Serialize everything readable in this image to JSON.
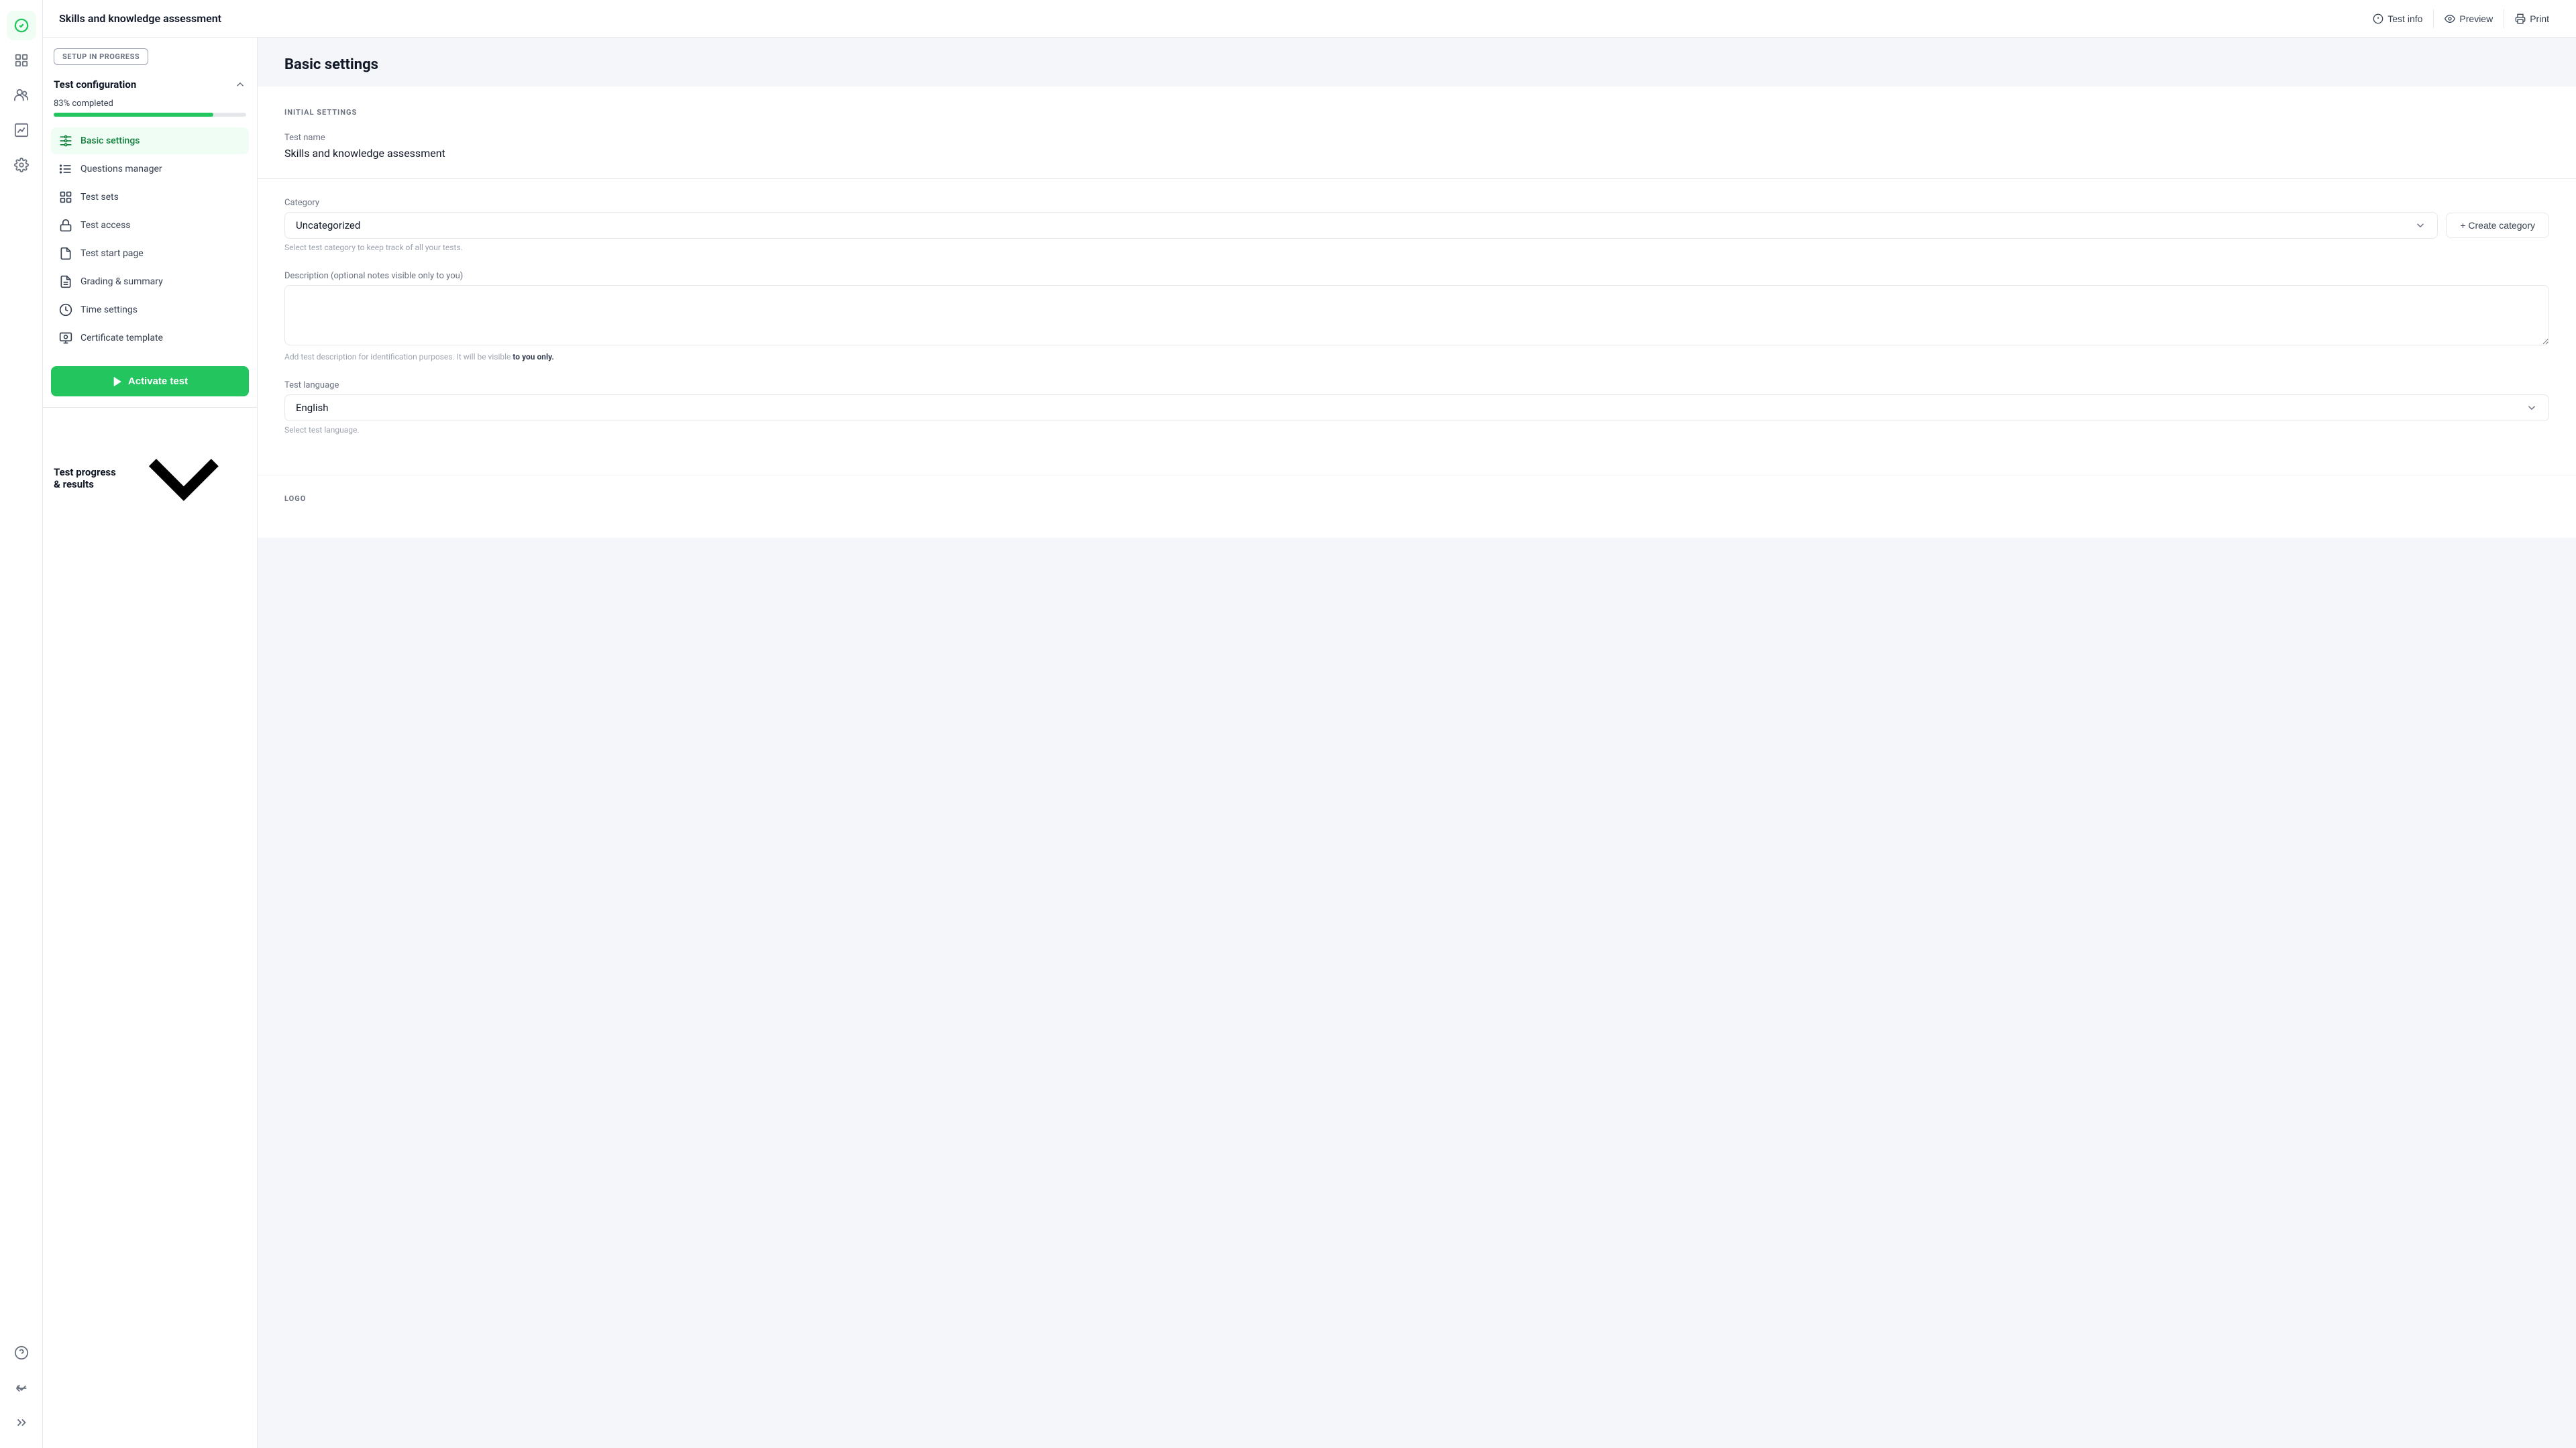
{
  "app": {
    "title": "Skills and knowledge assessment"
  },
  "header": {
    "title": "Skills and knowledge assessment",
    "actions": [
      {
        "id": "test-info",
        "label": "Test info",
        "icon": "info-circle"
      },
      {
        "id": "preview",
        "label": "Preview",
        "icon": "eye"
      },
      {
        "id": "print",
        "label": "Print",
        "icon": "printer"
      }
    ]
  },
  "sidebar": {
    "setup_badge": "SETUP IN PROGRESS",
    "section1": {
      "title": "Test configuration",
      "progress_label": "83% completed",
      "progress_value": 83
    },
    "nav_items": [
      {
        "id": "basic-settings",
        "label": "Basic settings",
        "active": true,
        "icon": "settings-sliders"
      },
      {
        "id": "questions-manager",
        "label": "Questions manager",
        "active": false,
        "icon": "list-adjust"
      },
      {
        "id": "test-sets",
        "label": "Test sets",
        "active": false,
        "icon": "grid"
      },
      {
        "id": "test-access",
        "label": "Test access",
        "active": false,
        "icon": "lock"
      },
      {
        "id": "test-start-page",
        "label": "Test start page",
        "active": false,
        "icon": "file-empty"
      },
      {
        "id": "grading-summary",
        "label": "Grading & summary",
        "active": false,
        "icon": "document-list"
      },
      {
        "id": "time-settings",
        "label": "Time settings",
        "active": false,
        "icon": "clock"
      },
      {
        "id": "certificate-template",
        "label": "Certificate template",
        "active": false,
        "icon": "certificate"
      }
    ],
    "activate_btn": "Activate test",
    "section2": {
      "title": "Test progress & results"
    }
  },
  "main": {
    "page_title": "Basic settings",
    "section_label": "INITIAL SETTINGS",
    "test_name": {
      "label": "Test name",
      "value": "Skills and knowledge assessment"
    },
    "category": {
      "label": "Category",
      "value": "Uncategorized",
      "hint": "Select test category to keep track of all your tests.",
      "create_btn": "+ Create category"
    },
    "description": {
      "label": "Description (optional notes visible only to you)",
      "hint_pre": "Add test description for identification purposes. It will be visible ",
      "hint_bold": "to you only.",
      "placeholder": ""
    },
    "language": {
      "label": "Test language",
      "value": "English",
      "hint": "Select test language."
    },
    "second_section_label": "LOGO"
  },
  "icons": {
    "check_circle": "✓",
    "grid": "⊞",
    "users": "👥",
    "chart": "📊",
    "gear": "⚙",
    "help": "?",
    "arrow_left": "←",
    "chevrons": "»"
  }
}
